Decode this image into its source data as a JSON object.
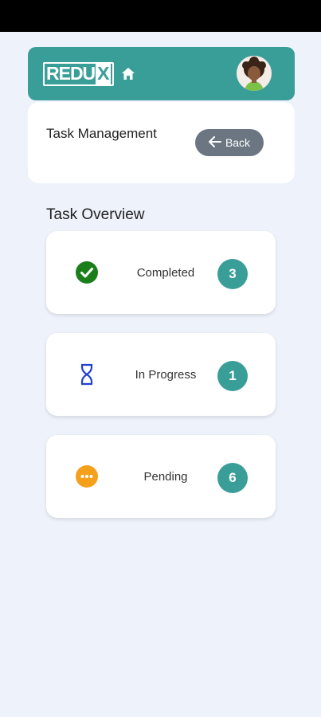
{
  "header": {
    "logo_text": "REDU",
    "logo_x": "X",
    "brand_color": "#3a9e98"
  },
  "title_card": {
    "title": "Task Management",
    "back_label": "Back"
  },
  "overview": {
    "title": "Task Overview",
    "items": [
      {
        "label": "Completed",
        "count": "3",
        "icon": "check-circle-icon",
        "icon_color": "#1a7f1a"
      },
      {
        "label": "In Progress",
        "count": "1",
        "icon": "hourglass-icon",
        "icon_color": "#1f3fd1"
      },
      {
        "label": "Pending",
        "count": "6",
        "icon": "more-dots-icon",
        "icon_color": "#f5a01a"
      }
    ]
  }
}
